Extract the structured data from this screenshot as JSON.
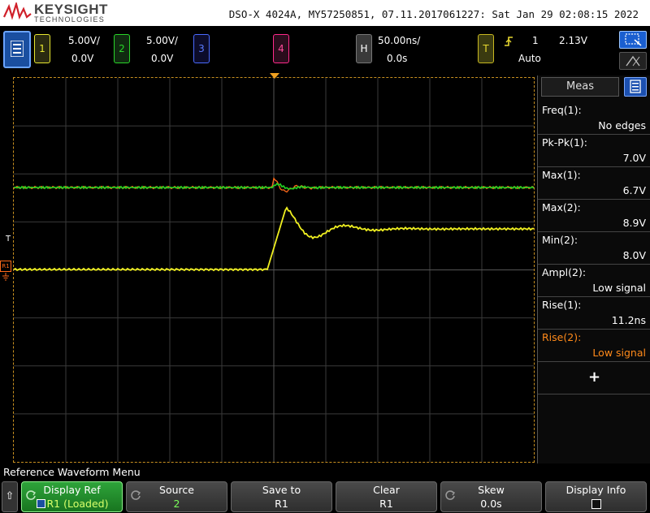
{
  "banner": {
    "brand": "KEYSIGHT",
    "brand_sub": "TECHNOLOGIES",
    "instrument": "DSO-X 4024A, MY57250851, 07.11.2017061227: Sat Jan 29 02:08:15 2022"
  },
  "channels": {
    "ch1": {
      "num": "1",
      "scale": "5.00V/",
      "offset": "0.0V",
      "color": "#e8e830"
    },
    "ch2": {
      "num": "2",
      "scale": "5.00V/",
      "offset": "0.0V",
      "color": "#29d629"
    },
    "ch3": {
      "num": "3",
      "color": "#5a7aff"
    },
    "ch4": {
      "num": "4",
      "color": "#ff4a9a"
    }
  },
  "horizontal": {
    "label": "H",
    "timebase": "50.00ns/",
    "delay": "0.0s"
  },
  "trigger": {
    "label": "T",
    "source": "1",
    "level": "2.13V",
    "mode": "Auto",
    "color": "#e8d830"
  },
  "markers": {
    "trig_level": "T",
    "ref": "R1"
  },
  "meas_panel": {
    "title": "Meas",
    "rows": [
      {
        "name": "Freq(1):",
        "value": "No edges"
      },
      {
        "name": "Pk-Pk(1):",
        "value": "7.0V"
      },
      {
        "name": "Max(1):",
        "value": "6.7V"
      },
      {
        "name": "Max(2):",
        "value": "8.9V"
      },
      {
        "name": "Min(2):",
        "value": "8.0V"
      },
      {
        "name": "Ampl(2):",
        "value": "Low signal"
      },
      {
        "name": "Rise(1):",
        "value": "11.2ns"
      },
      {
        "name": "Rise(2):",
        "value": "Low signal"
      }
    ],
    "add_label": "+"
  },
  "softkeys": {
    "menu_title": "Reference Waveform Menu",
    "back": "⇧",
    "keys": [
      {
        "label": "Display Ref",
        "value": "R1 (Loaded)"
      },
      {
        "label": "Source",
        "value": "2"
      },
      {
        "label": "Save to",
        "value": "R1"
      },
      {
        "label": "Clear",
        "value": "R1"
      },
      {
        "label": "Skew",
        "value": "0.0s"
      },
      {
        "label": "Display Info",
        "value": ""
      }
    ]
  },
  "waveforms": {
    "ch1_color": "#f0f020",
    "ch2_color": "#22d422",
    "ref_color": "#ff6a1a"
  }
}
